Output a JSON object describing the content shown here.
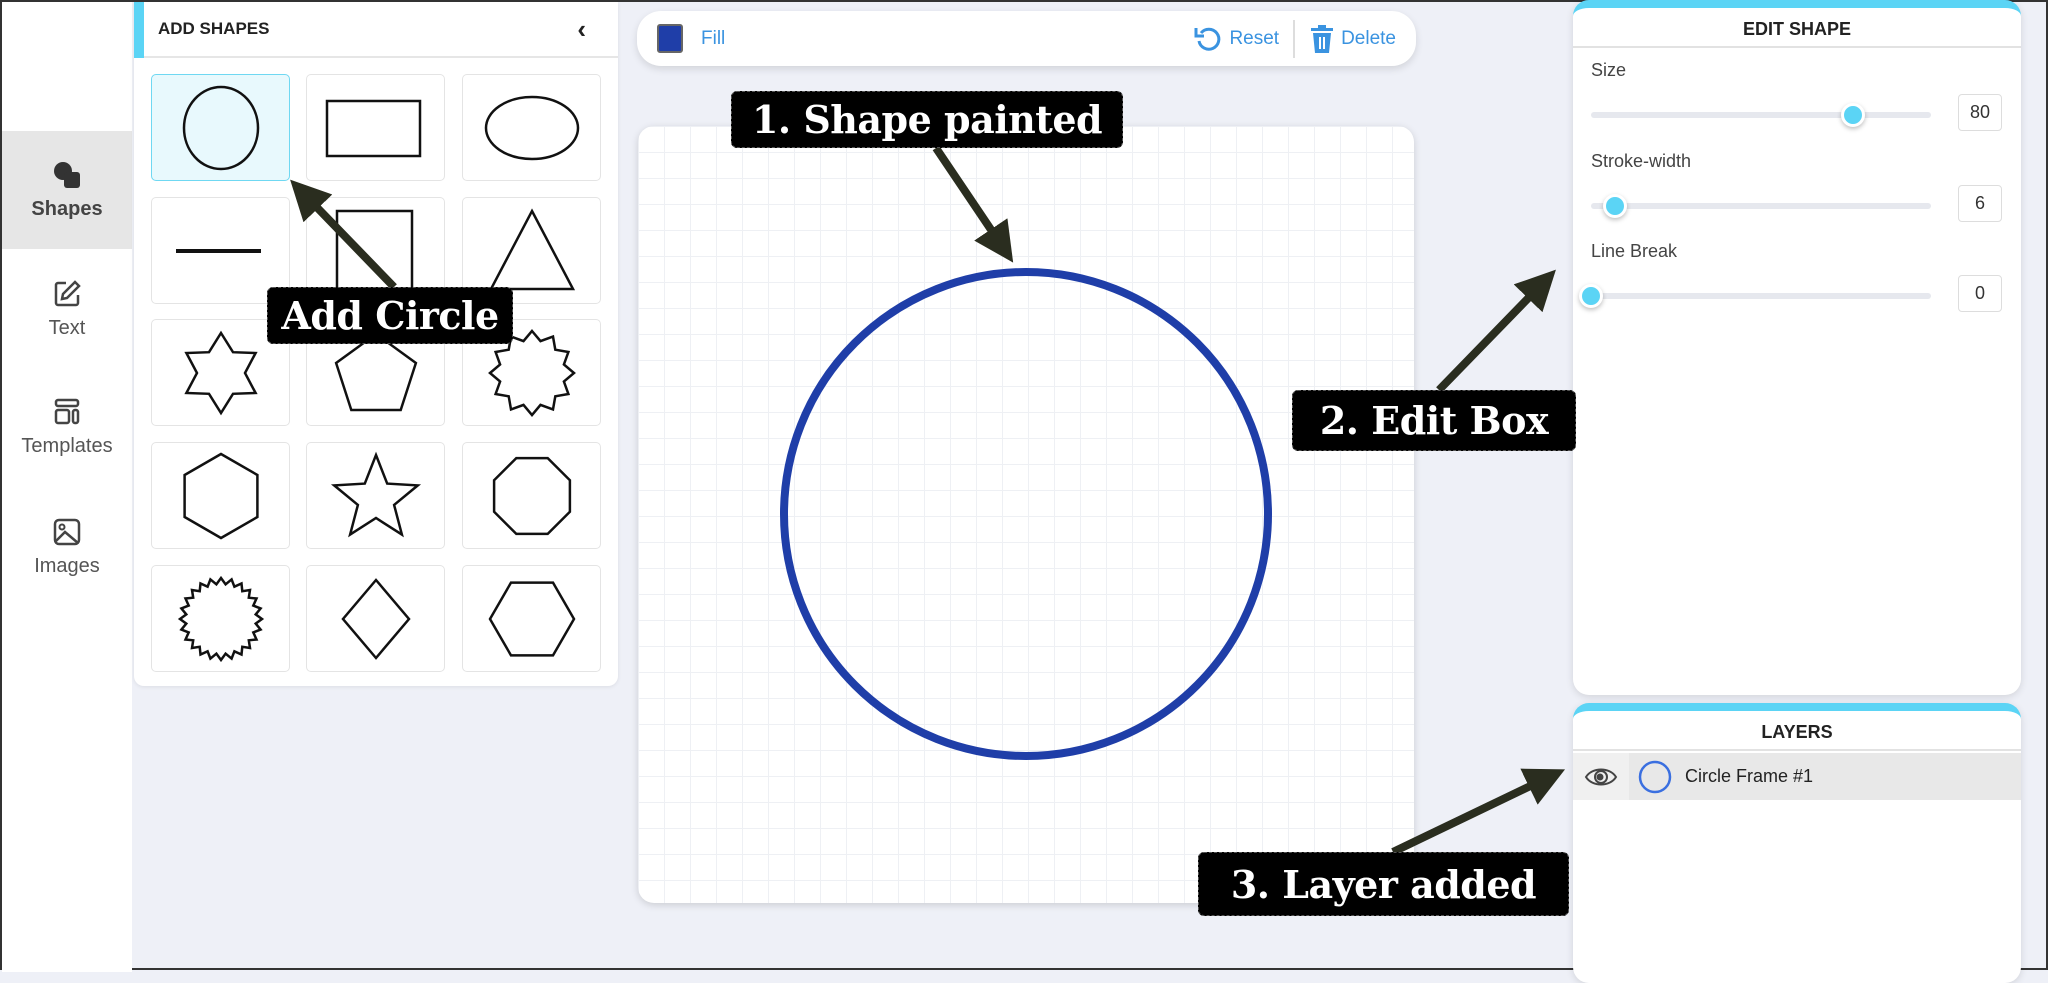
{
  "sidebar": {
    "items": [
      {
        "label": "Shapes",
        "icon": "shapes-icon",
        "active": true
      },
      {
        "label": "Text",
        "icon": "edit-icon"
      },
      {
        "label": "Templates",
        "icon": "templates-icon"
      },
      {
        "label": "Images",
        "icon": "image-icon"
      }
    ]
  },
  "shapes_panel": {
    "title": "ADD SHAPES",
    "shapes": [
      "circle",
      "rectangle",
      "ellipse",
      "line",
      "square",
      "triangle",
      "star-6",
      "pentagon",
      "starburst-12",
      "hexagon",
      "star-5",
      "octagon",
      "starburst-24",
      "diamond",
      "hexagon-flat"
    ],
    "selected": "circle"
  },
  "toolbar": {
    "fill_label": "Fill",
    "fill_color": "#1f3ea8",
    "reset_label": "Reset",
    "delete_label": "Delete",
    "accent": "#3a93e0"
  },
  "canvas": {
    "shape": "circle",
    "stroke_color": "#1f3ea8"
  },
  "edit_shape": {
    "title": "EDIT SHAPE",
    "controls": [
      {
        "label": "Size",
        "value": "80",
        "fill_percent": 77
      },
      {
        "label": "Stroke-width",
        "value": "6",
        "fill_percent": 7
      },
      {
        "label": "Line Break",
        "value": "0",
        "fill_percent": 0
      }
    ]
  },
  "layers": {
    "title": "LAYERS",
    "items": [
      {
        "name": "Circle Frame #1",
        "icon": "circle-icon",
        "visible": true
      }
    ]
  },
  "annotations": {
    "shape_painted": "1. Shape painted",
    "add_circle": "Add Circle",
    "edit_box": "2. Edit Box",
    "layer_added": "3. Layer added"
  }
}
